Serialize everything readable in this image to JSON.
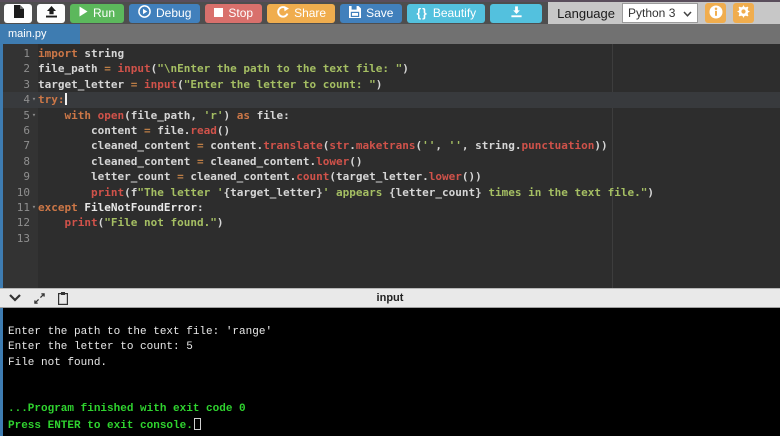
{
  "toolbar": {
    "run_label": "Run",
    "debug_label": "Debug",
    "stop_label": "Stop",
    "share_label": "Share",
    "save_label": "Save",
    "beautify_icon": "{}",
    "beautify_label": "Beautify",
    "language_label": "Language",
    "language_value": "Python 3"
  },
  "tabbar": {
    "active_tab": "main.py"
  },
  "editor": {
    "cursor_line": 4,
    "fold_lines": [
      4,
      5,
      11
    ],
    "fold_glyph": "▾",
    "lines": [
      {
        "n": 1,
        "t": [
          [
            "k",
            "import"
          ],
          [
            "p",
            " string"
          ]
        ]
      },
      {
        "n": 2,
        "t": [
          [
            "p",
            "file_path "
          ],
          [
            "o",
            "="
          ],
          [
            "p",
            " "
          ],
          [
            "f",
            "input"
          ],
          [
            "p",
            "("
          ],
          [
            "s",
            "\"\\nEnter the path to the text file: \""
          ],
          [
            "p",
            ")"
          ]
        ]
      },
      {
        "n": 3,
        "t": [
          [
            "p",
            "target_letter "
          ],
          [
            "o",
            "="
          ],
          [
            "p",
            " "
          ],
          [
            "f",
            "input"
          ],
          [
            "p",
            "("
          ],
          [
            "s",
            "\"Enter the letter to count: \""
          ],
          [
            "p",
            ")"
          ]
        ]
      },
      {
        "n": 4,
        "t": [
          [
            "k",
            "try:"
          ]
        ]
      },
      {
        "n": 5,
        "t": [
          [
            "p",
            "    "
          ],
          [
            "k",
            "with"
          ],
          [
            "p",
            " "
          ],
          [
            "f",
            "open"
          ],
          [
            "p",
            "(file_path, "
          ],
          [
            "s",
            "'r'"
          ],
          [
            "p",
            ") "
          ],
          [
            "k",
            "as"
          ],
          [
            "p",
            " file:"
          ]
        ]
      },
      {
        "n": 6,
        "t": [
          [
            "p",
            "        content "
          ],
          [
            "o",
            "="
          ],
          [
            "p",
            " file."
          ],
          [
            "f",
            "read"
          ],
          [
            "p",
            "()"
          ]
        ]
      },
      {
        "n": 7,
        "t": [
          [
            "p",
            "        cleaned_content "
          ],
          [
            "o",
            "="
          ],
          [
            "p",
            " content."
          ],
          [
            "f",
            "translate"
          ],
          [
            "p",
            "("
          ],
          [
            "f",
            "str"
          ],
          [
            "p",
            "."
          ],
          [
            "f",
            "maketrans"
          ],
          [
            "p",
            "("
          ],
          [
            "s",
            "''"
          ],
          [
            "p",
            ", "
          ],
          [
            "s",
            "''"
          ],
          [
            "p",
            ", string."
          ],
          [
            "f",
            "punctuation"
          ],
          [
            "p",
            "))"
          ]
        ]
      },
      {
        "n": 8,
        "t": [
          [
            "p",
            "        cleaned_content "
          ],
          [
            "o",
            "="
          ],
          [
            "p",
            " cleaned_content."
          ],
          [
            "f",
            "lower"
          ],
          [
            "p",
            "()"
          ]
        ]
      },
      {
        "n": 9,
        "t": [
          [
            "p",
            "        letter_count "
          ],
          [
            "o",
            "="
          ],
          [
            "p",
            " cleaned_content."
          ],
          [
            "f",
            "count"
          ],
          [
            "p",
            "(target_letter."
          ],
          [
            "f",
            "lower"
          ],
          [
            "p",
            "())"
          ]
        ]
      },
      {
        "n": 10,
        "t": [
          [
            "p",
            "        "
          ],
          [
            "f",
            "print"
          ],
          [
            "p",
            "(f"
          ],
          [
            "s",
            "\"The letter '"
          ],
          [
            "p",
            "{target_letter}"
          ],
          [
            "s",
            "' appears "
          ],
          [
            "p",
            "{letter_count}"
          ],
          [
            "s",
            " times in the text file.\""
          ],
          [
            "p",
            ")"
          ]
        ]
      },
      {
        "n": 11,
        "t": [
          [
            "k",
            "except"
          ],
          [
            "p",
            " "
          ],
          [
            "b",
            "FileNotFoundError"
          ],
          [
            "p",
            ":"
          ]
        ]
      },
      {
        "n": 12,
        "t": [
          [
            "p",
            "    "
          ],
          [
            "f",
            "print"
          ],
          [
            "p",
            "("
          ],
          [
            "s",
            "\"File not found.\""
          ],
          [
            "p",
            ")"
          ]
        ]
      },
      {
        "n": 13,
        "t": []
      }
    ]
  },
  "console_panel": {
    "header_label": "input",
    "lines": [
      {
        "text": "",
        "style": "plain"
      },
      {
        "text": "Enter the path to the text file: 'range'",
        "style": "plain"
      },
      {
        "text": "Enter the letter to count: 5",
        "style": "plain"
      },
      {
        "text": "File not found.",
        "style": "plain"
      },
      {
        "text": "",
        "style": "plain"
      },
      {
        "text": "",
        "style": "plain"
      },
      {
        "text": "...Program finished with exit code 0",
        "style": "success"
      },
      {
        "text": "Press ENTER to exit console.",
        "style": "success",
        "cursor": true
      }
    ]
  },
  "colors": {
    "accent_blue": "#3e7cb1",
    "run_green": "#5cb85c",
    "debug_save_blue": "#4180bc",
    "stop_red": "#d9706c",
    "share_orange": "#f0ad4e",
    "beautify_cyan": "#53c1de",
    "settings_orange": "#f0ad4e",
    "editor_bg": "#2d2d2d",
    "keyword_orange": "#cc7747",
    "function_red": "#d0524a",
    "string_green": "#a5bf63",
    "console_green": "#2fd32f"
  }
}
